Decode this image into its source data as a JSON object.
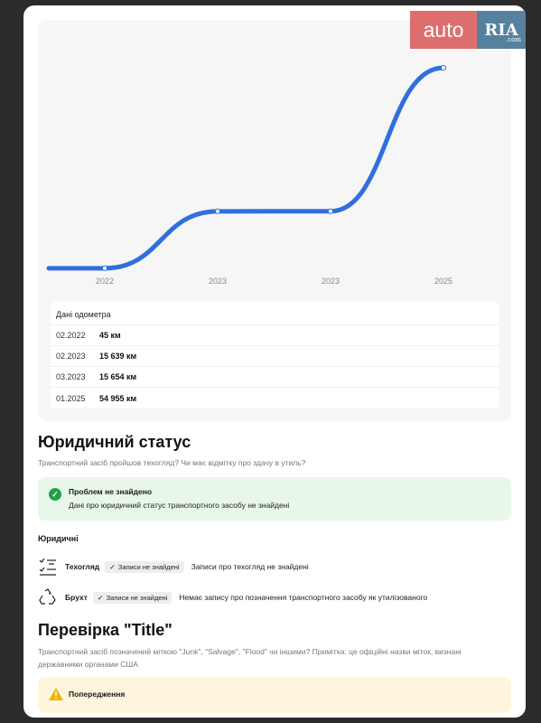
{
  "chart_data": {
    "type": "line",
    "title": "",
    "xlabel": "",
    "ylabel": "",
    "categories": [
      "2022",
      "2023",
      "2023",
      "2025"
    ],
    "series": [
      {
        "values": [
          45,
          15639,
          15654,
          54955
        ]
      }
    ],
    "ylim": [
      0,
      54955
    ],
    "grid": false,
    "color": "#2f6fde"
  },
  "odometer": {
    "title": "Дані одометра",
    "rows": [
      {
        "date": "02.2022",
        "km": "45 км"
      },
      {
        "date": "02.2023",
        "km": "15 639 км"
      },
      {
        "date": "03.2023",
        "km": "15 654 км"
      },
      {
        "date": "01.2025",
        "km": "54 955 км"
      }
    ]
  },
  "legal": {
    "heading": "Юридичний статус",
    "subtitle": "Транспортний засіб пройшов техогляд? Чи має відмітку про здачу в утиль?",
    "success_title": "Проблем не знайдено",
    "success_text": "Дані про юридичний статус транспортного засобу не знайдені",
    "section_label": "Юридичні",
    "items": [
      {
        "name": "Техогляд",
        "badge": "Записи не знайдені",
        "desc": "Записи про техогляд не знайдені",
        "icon": "checklist-icon"
      },
      {
        "name": "Брухт",
        "badge": "Записи не знайдені",
        "desc": "Немає запису про позначення транспортного засобу як утилізованого",
        "icon": "recycle-icon"
      }
    ]
  },
  "title_check": {
    "heading": "Перевірка \"Title\"",
    "subtitle": "Транспортний засіб позначений міткою \"Junk\", \"Salvage\", \"Flood\" чи іншими? Примітка: це офіційні назви міток, визнані державними органами США",
    "warning_title": "Попередження"
  },
  "logo": {
    "auto": "auto",
    "ria": "RIA",
    "ria_suffix": ".com"
  },
  "colors": {
    "accent": "#2f6fde",
    "success": "#24a148",
    "warning": "#f0b400"
  }
}
